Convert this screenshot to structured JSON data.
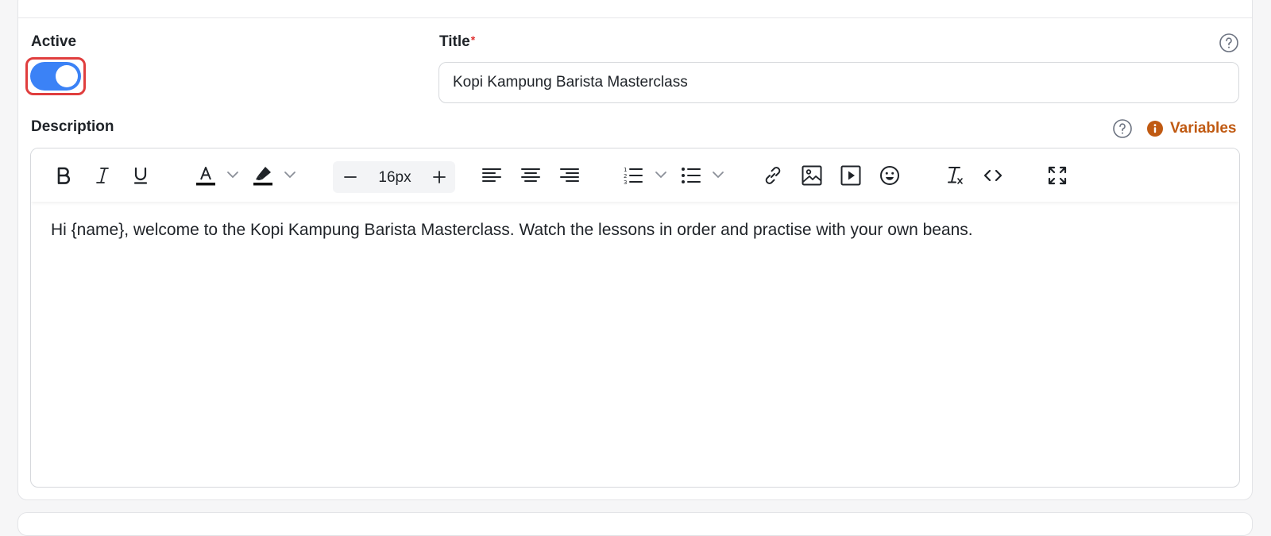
{
  "form": {
    "active": {
      "label": "Active",
      "enabled": true
    },
    "title": {
      "label": "Title",
      "required_mark": "*",
      "value": "Kopi Kampung Barista Masterclass"
    },
    "description": {
      "label": "Description",
      "variables_label": "Variables",
      "toolbar": {
        "font_size": "16px",
        "buttons": [
          "bold-icon",
          "italic-icon",
          "underline-icon",
          "text-color-icon",
          "highlight-icon",
          "decrease-font-icon",
          "increase-font-icon",
          "align-left-icon",
          "align-center-icon",
          "align-right-icon",
          "ordered-list-icon",
          "bullet-list-icon",
          "link-icon",
          "image-icon",
          "video-icon",
          "emoji-icon",
          "clear-format-icon",
          "code-icon",
          "fullscreen-icon"
        ]
      },
      "content": "Hi {name}, welcome to the Kopi Kampung Barista Masterclass. Watch the lessons in order and practise with your own beans."
    }
  },
  "colors": {
    "accent": "#3b82f6",
    "focus_ring": "#e03e3e",
    "variables": "#c05a12",
    "required": "#e03131"
  }
}
